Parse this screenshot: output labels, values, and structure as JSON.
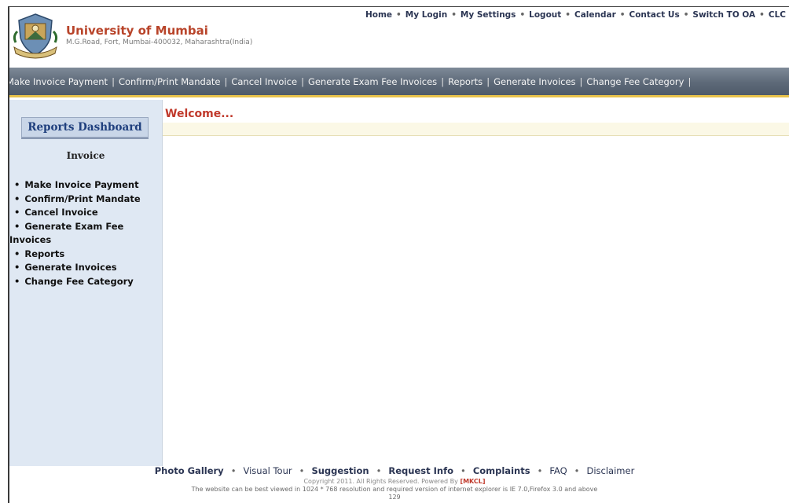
{
  "header": {
    "title": "University of Mumbai",
    "address": "M.G.Road, Fort, Mumbai-400032, Maharashtra(India)",
    "logo_icon": "university-crest-icon",
    "top_links": [
      "Home",
      "My Login",
      "My Settings",
      "Logout",
      "Calendar",
      "Contact Us",
      "Switch TO OA",
      "CLC"
    ]
  },
  "nav": {
    "items": [
      "Make Invoice Payment",
      "Confirm/Print Mandate",
      "Cancel Invoice",
      "Generate Exam Fee Invoices",
      "Reports",
      "Generate Invoices",
      "Change Fee Category"
    ]
  },
  "sidebar": {
    "dashboard_title": "Reports Dashboard",
    "section_heading": "Invoice",
    "links": [
      "Make Invoice Payment",
      "Confirm/Print Mandate",
      "Cancel Invoice",
      "Generate Exam Fee",
      "Invoices",
      "Reports",
      "Generate Invoices",
      "Change Fee Category"
    ]
  },
  "main": {
    "welcome": "Welcome..."
  },
  "footer": {
    "links": [
      "Photo Gallery",
      "Visual Tour",
      "Suggestion",
      "Request Info",
      "Complaints",
      "FAQ",
      "Disclaimer"
    ],
    "copyright": "Copyright 2011. All Rights Reserved. Powered By",
    "powered_by": "[MKCL]",
    "viewed_note": "The website can be best viewed in 1024 * 768 resolution and required version of internet explorer is IE 7.0,Firefox 3.0 and above",
    "counter": "129"
  },
  "colors": {
    "brand": "#b8442a",
    "nav_bg": "#5d6978",
    "nav_border": "#e8c24a",
    "sidebar_bg": "#dfe8f3",
    "welcome": "#c0392b"
  }
}
